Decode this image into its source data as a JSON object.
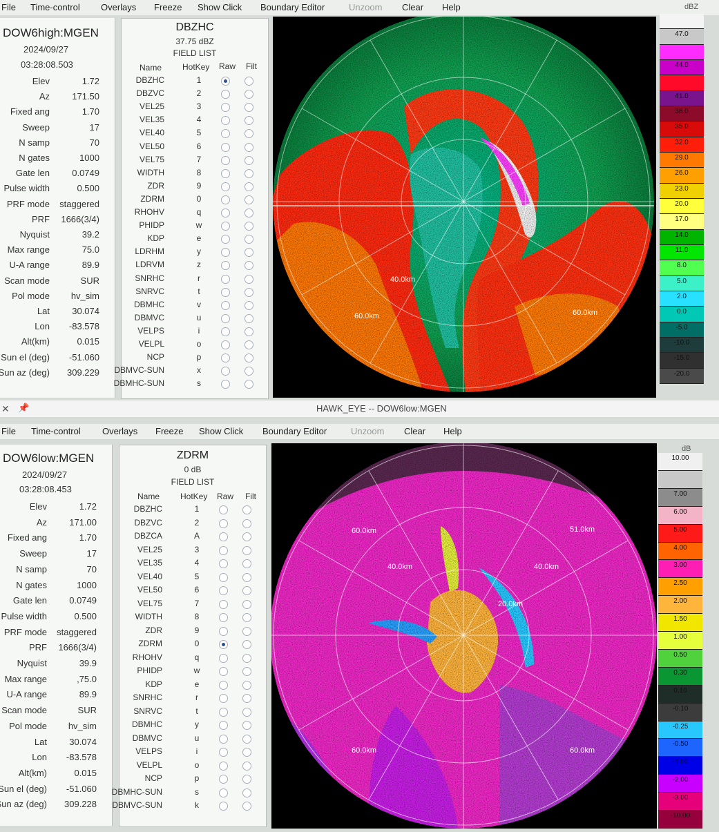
{
  "top": {
    "menu": [
      {
        "label": "File",
        "enabled": true
      },
      {
        "label": "Time-control",
        "enabled": true
      },
      {
        "label": "Overlays",
        "enabled": true
      },
      {
        "label": "Freeze",
        "enabled": true
      },
      {
        "label": "Show Click",
        "enabled": true
      },
      {
        "label": "Boundary Editor",
        "enabled": true
      },
      {
        "label": "Unzoom",
        "enabled": false
      },
      {
        "label": "Clear",
        "enabled": true
      },
      {
        "label": "Help",
        "enabled": true
      }
    ],
    "radar_name": "DOW6high:MGEN",
    "date": "2024/09/27",
    "time": "03:28:08.503",
    "params": [
      {
        "label": "Elev",
        "value": "1.72"
      },
      {
        "label": "Az",
        "value": "171.50"
      },
      {
        "label": "Fixed ang",
        "value": "1.70"
      },
      {
        "label": "Sweep",
        "value": "17"
      },
      {
        "label": "N samp",
        "value": "70"
      },
      {
        "label": "N gates",
        "value": "1000"
      },
      {
        "label": "Gate len",
        "value": "0.0749"
      },
      {
        "label": "Pulse width",
        "value": "0.500"
      },
      {
        "label": "PRF mode",
        "value": "staggered"
      },
      {
        "label": "PRF",
        "value": "1666(3/4)"
      },
      {
        "label": "Nyquist",
        "value": "39.2"
      },
      {
        "label": "Max range",
        "value": "75.0"
      },
      {
        "label": "U-A range",
        "value": "89.9"
      },
      {
        "label": "Scan mode",
        "value": "SUR"
      },
      {
        "label": "Pol mode",
        "value": "hv_sim"
      },
      {
        "label": "Lat",
        "value": "30.074"
      },
      {
        "label": "Lon",
        "value": "-83.578"
      },
      {
        "label": "Alt(km)",
        "value": "0.015"
      },
      {
        "label": "Sun el (deg)",
        "value": "-51.060"
      },
      {
        "label": "Sun az (deg)",
        "value": "309.229"
      }
    ],
    "field_name": "DBZHC",
    "field_value": "37.75 dBZ",
    "field_list_label": "FIELD LIST",
    "col_headers": {
      "name": "Name",
      "hotkey": "HotKey",
      "raw": "Raw",
      "filt": "Filt"
    },
    "fields": [
      {
        "name": "DBZHC",
        "key": "1",
        "selected": true
      },
      {
        "name": "DBZVC",
        "key": "2",
        "selected": false
      },
      {
        "name": "VEL25",
        "key": "3",
        "selected": false
      },
      {
        "name": "VEL35",
        "key": "4",
        "selected": false
      },
      {
        "name": "VEL40",
        "key": "5",
        "selected": false
      },
      {
        "name": "VEL50",
        "key": "6",
        "selected": false
      },
      {
        "name": "VEL75",
        "key": "7",
        "selected": false
      },
      {
        "name": "WIDTH",
        "key": "8",
        "selected": false
      },
      {
        "name": "ZDR",
        "key": "9",
        "selected": false
      },
      {
        "name": "ZDRM",
        "key": "0",
        "selected": false
      },
      {
        "name": "RHOHV",
        "key": "q",
        "selected": false
      },
      {
        "name": "PHIDP",
        "key": "w",
        "selected": false
      },
      {
        "name": "KDP",
        "key": "e",
        "selected": false
      },
      {
        "name": "LDRHM",
        "key": "y",
        "selected": false
      },
      {
        "name": "LDRVM",
        "key": "z",
        "selected": false
      },
      {
        "name": "SNRHC",
        "key": "r",
        "selected": false
      },
      {
        "name": "SNRVC",
        "key": "t",
        "selected": false
      },
      {
        "name": "DBMHC",
        "key": "v",
        "selected": false
      },
      {
        "name": "DBMVC",
        "key": "u",
        "selected": false
      },
      {
        "name": "VELPS",
        "key": "i",
        "selected": false
      },
      {
        "name": "VELPL",
        "key": "o",
        "selected": false
      },
      {
        "name": "NCP",
        "key": "p",
        "selected": false
      },
      {
        "name": "DBMVC-SUN",
        "key": "x",
        "selected": false
      },
      {
        "name": "DBMHC-SUN",
        "key": "s",
        "selected": false
      }
    ],
    "range_labels": [
      "40.0km",
      "60.0km",
      "60.0km"
    ],
    "colorbar_unit": "dBZ",
    "colorbar": [
      {
        "label": "",
        "color": "#f4f4f4"
      },
      {
        "label": "47.0",
        "color": "#c8c8c8"
      },
      {
        "label": "",
        "color": "#ff2cff"
      },
      {
        "label": "44.0",
        "color": "#c800c8"
      },
      {
        "label": "",
        "color": "#ff0a28"
      },
      {
        "label": "41.0",
        "color": "#7a148c"
      },
      {
        "label": "38.0",
        "color": "#8c0a2a"
      },
      {
        "label": "35.0",
        "color": "#d80a0a"
      },
      {
        "label": "32.0",
        "color": "#ff1e0a"
      },
      {
        "label": "29.0",
        "color": "#ff7800"
      },
      {
        "label": "26.0",
        "color": "#ffa000"
      },
      {
        "label": "23.0",
        "color": "#f0d000"
      },
      {
        "label": "20.0",
        "color": "#ffff3c"
      },
      {
        "label": "17.0",
        "color": "#ffff80"
      },
      {
        "label": "14.0",
        "color": "#00b400"
      },
      {
        "label": "11.0",
        "color": "#00e600"
      },
      {
        "label": "8.0",
        "color": "#50ff50"
      },
      {
        "label": "5.0",
        "color": "#3cf0c8"
      },
      {
        "label": "2.0",
        "color": "#28e0ff"
      },
      {
        "label": "0.0",
        "color": "#00c8b4"
      },
      {
        "label": "-5.0",
        "color": "#006e64"
      },
      {
        "label": "-10.0",
        "color": "#1e3c3c"
      },
      {
        "label": "-15.0",
        "color": "#303030"
      },
      {
        "label": "-20.0",
        "color": "#4a4a4a"
      }
    ]
  },
  "bottom": {
    "window_title": "HAWK_EYE -- DOW6low:MGEN",
    "menu": [
      {
        "label": "File",
        "enabled": true
      },
      {
        "label": "Time-control",
        "enabled": true
      },
      {
        "label": "Overlays",
        "enabled": true
      },
      {
        "label": "Freeze",
        "enabled": true
      },
      {
        "label": "Show Click",
        "enabled": true
      },
      {
        "label": "Boundary Editor",
        "enabled": true
      },
      {
        "label": "Unzoom",
        "enabled": false
      },
      {
        "label": "Clear",
        "enabled": true
      },
      {
        "label": "Help",
        "enabled": true
      }
    ],
    "radar_name": "DOW6low:MGEN",
    "date": "2024/09/27",
    "time": "03:28:08.453",
    "params": [
      {
        "label": "Elev",
        "value": "1.72"
      },
      {
        "label": "Az",
        "value": "171.00"
      },
      {
        "label": "Fixed ang",
        "value": "1.70"
      },
      {
        "label": "Sweep",
        "value": "17"
      },
      {
        "label": "N samp",
        "value": "70"
      },
      {
        "label": "N gates",
        "value": "1000"
      },
      {
        "label": "Gate len",
        "value": "0.0749"
      },
      {
        "label": "Pulse width",
        "value": "0.500"
      },
      {
        "label": "PRF mode",
        "value": "staggered"
      },
      {
        "label": "PRF",
        "value": "1666(3/4)"
      },
      {
        "label": "Nyquist",
        "value": "39.9"
      },
      {
        "label": "Max range",
        "value": ",75.0"
      },
      {
        "label": "U-A range",
        "value": "89.9"
      },
      {
        "label": "Scan mode",
        "value": "SUR"
      },
      {
        "label": "Pol mode",
        "value": "hv_sim"
      },
      {
        "label": "Lat",
        "value": "30.074"
      },
      {
        "label": "Lon",
        "value": "-83.578"
      },
      {
        "label": "Alt(km)",
        "value": "0.015"
      },
      {
        "label": "Sun el (deg)",
        "value": "-51.060"
      },
      {
        "label": "Sun az (deg)",
        "value": "309.228"
      }
    ],
    "field_name": "ZDRM",
    "field_value": "0 dB",
    "field_list_label": "FIELD LIST",
    "col_headers": {
      "name": "Name",
      "hotkey": "HotKey",
      "raw": "Raw",
      "filt": "Filt"
    },
    "fields": [
      {
        "name": "DBZHC",
        "key": "1",
        "selected": false
      },
      {
        "name": "DBZVC",
        "key": "2",
        "selected": false
      },
      {
        "name": "DBZCA",
        "key": "A",
        "selected": false
      },
      {
        "name": "VEL25",
        "key": "3",
        "selected": false
      },
      {
        "name": "VEL35",
        "key": "4",
        "selected": false
      },
      {
        "name": "VEL40",
        "key": "5",
        "selected": false
      },
      {
        "name": "VEL50",
        "key": "6",
        "selected": false
      },
      {
        "name": "VEL75",
        "key": "7",
        "selected": false
      },
      {
        "name": "WIDTH",
        "key": "8",
        "selected": false
      },
      {
        "name": "ZDR",
        "key": "9",
        "selected": false
      },
      {
        "name": "ZDRM",
        "key": "0",
        "selected": true
      },
      {
        "name": "RHOHV",
        "key": "q",
        "selected": false
      },
      {
        "name": "PHIDP",
        "key": "w",
        "selected": false
      },
      {
        "name": "KDP",
        "key": "e",
        "selected": false
      },
      {
        "name": "SNRHC",
        "key": "r",
        "selected": false
      },
      {
        "name": "SNRVC",
        "key": "t",
        "selected": false
      },
      {
        "name": "DBMHC",
        "key": "y",
        "selected": false
      },
      {
        "name": "DBMVC",
        "key": "u",
        "selected": false
      },
      {
        "name": "VELPS",
        "key": "i",
        "selected": false
      },
      {
        "name": "VELPL",
        "key": "o",
        "selected": false
      },
      {
        "name": "NCP",
        "key": "p",
        "selected": false
      },
      {
        "name": "DBMHC-SUN",
        "key": "s",
        "selected": false
      },
      {
        "name": "DBMVC-SUN",
        "key": "k",
        "selected": false
      }
    ],
    "range_labels": [
      "60.0km",
      "51.0km",
      "40.0km",
      "40.0km",
      "20.0km",
      "60.0km",
      "60.0km"
    ],
    "colorbar_unit": "dB",
    "colorbar": [
      {
        "label": "10.00",
        "color": "#f0f0f0"
      },
      {
        "label": "",
        "color": "#c8c8c8"
      },
      {
        "label": "7.00",
        "color": "#8c8c8c"
      },
      {
        "label": "6.00",
        "color": "#f4b4c8"
      },
      {
        "label": "5.00",
        "color": "#ff1a1a"
      },
      {
        "label": "4.00",
        "color": "#ff6400"
      },
      {
        "label": "3.00",
        "color": "#ff1eb4"
      },
      {
        "label": "2.50",
        "color": "#ffa000"
      },
      {
        "label": "2.00",
        "color": "#ffb43c"
      },
      {
        "label": "1.50",
        "color": "#f0e600"
      },
      {
        "label": "1.00",
        "color": "#e6ff3c"
      },
      {
        "label": "0.50",
        "color": "#50d23c"
      },
      {
        "label": "0.30",
        "color": "#0a9632"
      },
      {
        "label": "0.10",
        "color": "#1e2d28"
      },
      {
        "label": "-0.10",
        "color": "#3c3c3c"
      },
      {
        "label": "-0.25",
        "color": "#28c8ff"
      },
      {
        "label": "-0.50",
        "color": "#1e64ff"
      },
      {
        "label": "-1.00",
        "color": "#0000e6"
      },
      {
        "label": "-2.00",
        "color": "#c800ff"
      },
      {
        "label": "-3.00",
        "color": "#e6007a"
      },
      {
        "label": "-10.00",
        "color": "#96003c"
      }
    ]
  }
}
